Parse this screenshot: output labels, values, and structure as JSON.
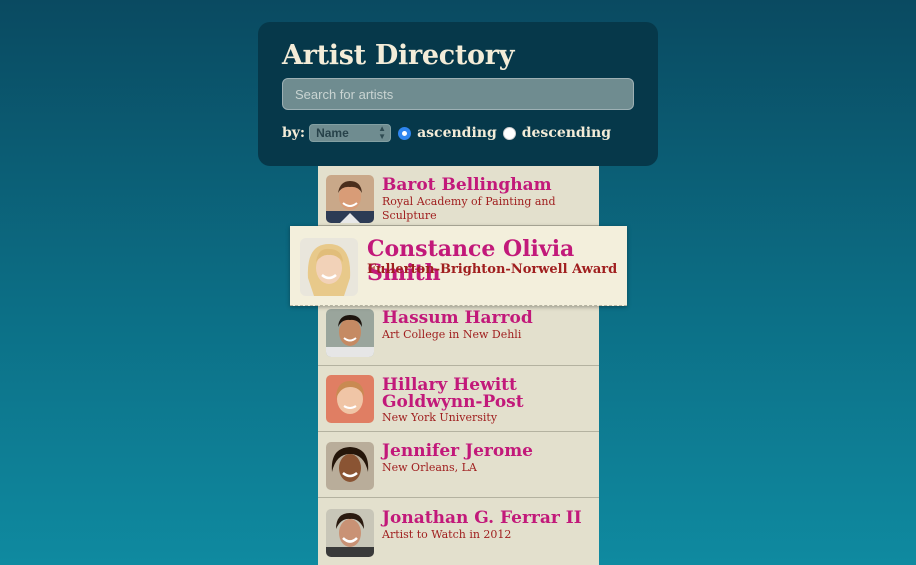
{
  "header": {
    "title": "Artist Directory",
    "search_placeholder": "Search for artists",
    "sort_by_label": "by:",
    "sort_by_value": "Name",
    "ascending_label": "ascending",
    "descending_label": "descending",
    "selected_order": "ascending"
  },
  "colors": {
    "name": "#c2197a",
    "subtitle": "#a01f1f",
    "panel": "#06384a",
    "list_bg": "#e3e0cd"
  },
  "artists": [
    {
      "name": "Barot Bellingham",
      "subtitle": "Royal Academy of Painting and Sculpture"
    },
    {
      "name": "Constance Olivia Smith",
      "subtitle": "Fullerton-Brighton-Norwell Award"
    },
    {
      "name": "Hassum Harrod",
      "subtitle": "Art College in New Dehli"
    },
    {
      "name": "Hillary Hewitt Goldwynn-Post",
      "subtitle": "New York University"
    },
    {
      "name": "Jennifer Jerome",
      "subtitle": "New Orleans, LA"
    },
    {
      "name": "Jonathan G. Ferrar II",
      "subtitle": "Artist to Watch in 2012"
    }
  ]
}
